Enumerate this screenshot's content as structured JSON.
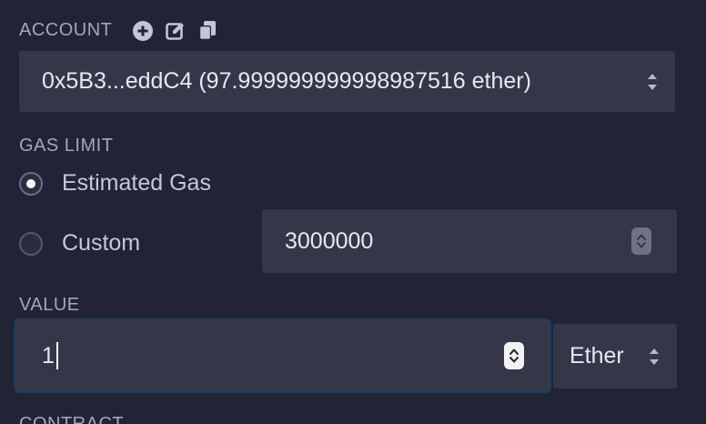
{
  "account": {
    "label": "ACCOUNT",
    "selected": "0x5B3...eddC4 (97.999999999998987516 ether)",
    "icons": [
      "plus-circle-icon",
      "edit-icon",
      "copy-icon"
    ]
  },
  "gas": {
    "label": "GAS LIMIT",
    "options": [
      {
        "label": "Estimated Gas",
        "checked": true
      },
      {
        "label": "Custom",
        "checked": false
      }
    ],
    "custom_value": "3000000"
  },
  "value": {
    "label": "VALUE",
    "amount": "1",
    "unit": "Ether"
  },
  "contract": {
    "label": "CONTRACT"
  },
  "colors": {
    "background": "#222336",
    "field": "#353749",
    "focus_border": "#1b3e5d",
    "label": "#a3a6bc"
  }
}
